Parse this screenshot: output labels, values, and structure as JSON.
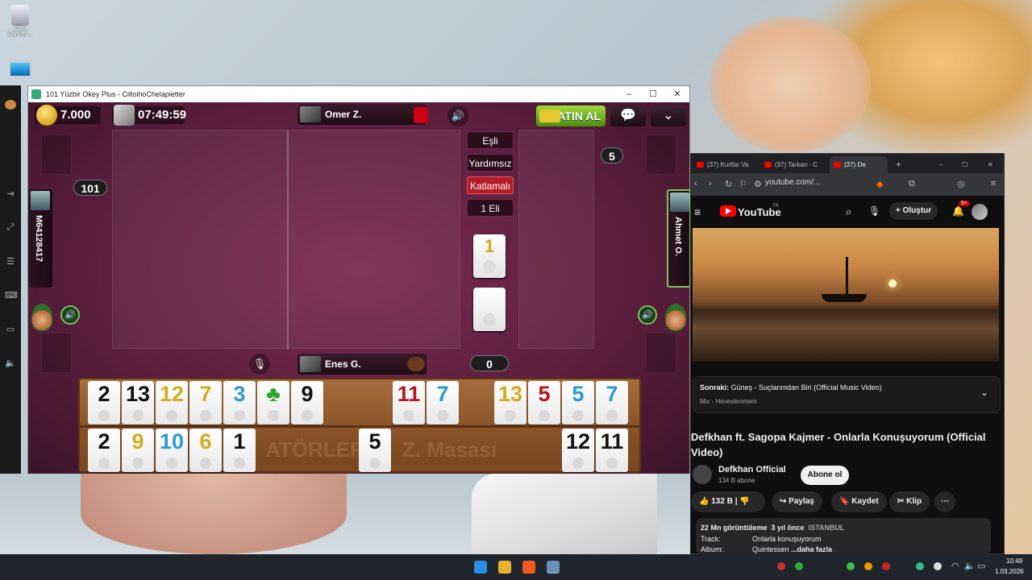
{
  "desktop": {
    "recycle_label": "Geri Dönüşü...",
    "colors": {
      "accent": "#b41c28",
      "green": "#7fc25a"
    }
  },
  "game_window": {
    "title": "101 Yüzbir Okey Plus - CiltoihoChelapietter",
    "controls": {
      "minimize": "–",
      "maximize": "☐",
      "close": "✕"
    },
    "coins": "7.000",
    "timer": "07:49:59",
    "top_player": "Omer Z.",
    "bottom_player": "Enes G.",
    "left_player": "M64128417",
    "right_player": "Ahmet O.",
    "buy_button": "SATIN AL",
    "score_left": "101",
    "score_right": "5",
    "score_bottom": "0",
    "modes": [
      "Eşli",
      "Yardımsız",
      "Katlamalı",
      "1 Eli"
    ],
    "indicator_tile": "1",
    "rack_row1": [
      {
        "v": "2",
        "c": "black"
      },
      {
        "v": "13",
        "c": "black"
      },
      {
        "v": "12",
        "c": "yellow"
      },
      {
        "v": "7",
        "c": "yellow"
      },
      {
        "v": "3",
        "c": "blue"
      },
      {
        "v": "♣",
        "c": "green"
      },
      {
        "v": "9",
        "c": "black"
      },
      {
        "v": "11",
        "c": "red"
      },
      {
        "v": "7",
        "c": "blue"
      },
      {
        "v": "13",
        "c": "yellow"
      },
      {
        "v": "5",
        "c": "red"
      },
      {
        "v": "5",
        "c": "blue"
      },
      {
        "v": "7",
        "c": "blue"
      }
    ],
    "rack_row2": [
      {
        "v": "2",
        "c": "black"
      },
      {
        "v": "9",
        "c": "yellow"
      },
      {
        "v": "10",
        "c": "blue"
      },
      {
        "v": "6",
        "c": "yellow"
      },
      {
        "v": "1",
        "c": "black"
      },
      {
        "v": "5",
        "c": "black"
      },
      {
        "v": "12",
        "c": "black"
      },
      {
        "v": "11",
        "c": "black"
      }
    ],
    "rack_watermark_1": "ATÖRLER -",
    "rack_watermark_2": "Z. Masası"
  },
  "browser": {
    "tabs": [
      "(37) Kurtlar Va",
      "(37) Tarkan - C",
      "(37) De"
    ],
    "url": "youtube.com/...",
    "yt_brand": "YouTube",
    "yt_region": "TR",
    "create_label": "Oluştur",
    "notif_count": "9+",
    "next_label": "Sonraki:",
    "next_title": "Güneş - Suçlanmdan Biri (Official Music Video)",
    "next_mix": "Mix - Heveslenmem",
    "video_title": "Defkhan ft. Sagopa Kajmer - Onlarla Konuşuyorum (Official Video)",
    "channel": "Defkhan Official",
    "subscribers": "134 B abone",
    "subscribe_label": "Abone ol",
    "likes": "132 B",
    "share": "Paylaş",
    "save": "Kaydet",
    "clip": "Klip",
    "views": "22 Mn görüntüleme",
    "age": "3 yıl önce",
    "location": "ISTANBUL",
    "track_label": "Track:",
    "track_value": "Onlarla konuşuyorum",
    "album_label": "Album:",
    "album_value": "Quintessen",
    "more": "...daha fazla"
  },
  "taskbar": {
    "time": "10:49",
    "date": "1.03.2026"
  }
}
